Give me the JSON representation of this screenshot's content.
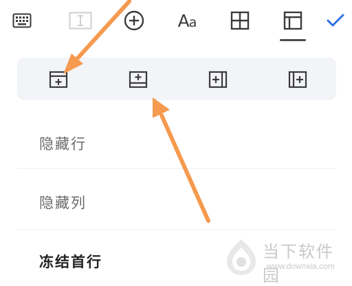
{
  "toolbar": {
    "tabs": [
      {
        "id": "keyboard",
        "icon": "keyboard-icon"
      },
      {
        "id": "text-format",
        "icon": "text-cursor-icon"
      },
      {
        "id": "insert",
        "icon": "circle-plus-icon"
      },
      {
        "id": "font",
        "icon": "font-aa-icon",
        "label_big": "A",
        "label_small": "a"
      },
      {
        "id": "cell",
        "icon": "grid-icon"
      },
      {
        "id": "table",
        "icon": "table-layout-icon",
        "selected": true
      },
      {
        "id": "done",
        "icon": "checkmark-icon"
      }
    ],
    "accent_color": "#2f6fe0"
  },
  "insert_bar": {
    "buttons": [
      {
        "icon": "insert-row-above-icon"
      },
      {
        "icon": "insert-row-below-icon"
      },
      {
        "icon": "insert-column-right-icon"
      },
      {
        "icon": "insert-column-left-icon"
      }
    ]
  },
  "menu": {
    "items": [
      {
        "label": "隐藏行"
      },
      {
        "label": "隐藏列"
      },
      {
        "label": "冻结首行"
      }
    ]
  },
  "annotation": {
    "arrow_color": "#f59a4f"
  },
  "watermark": {
    "brand": "当下软件园",
    "url": "www.downxia.com"
  }
}
